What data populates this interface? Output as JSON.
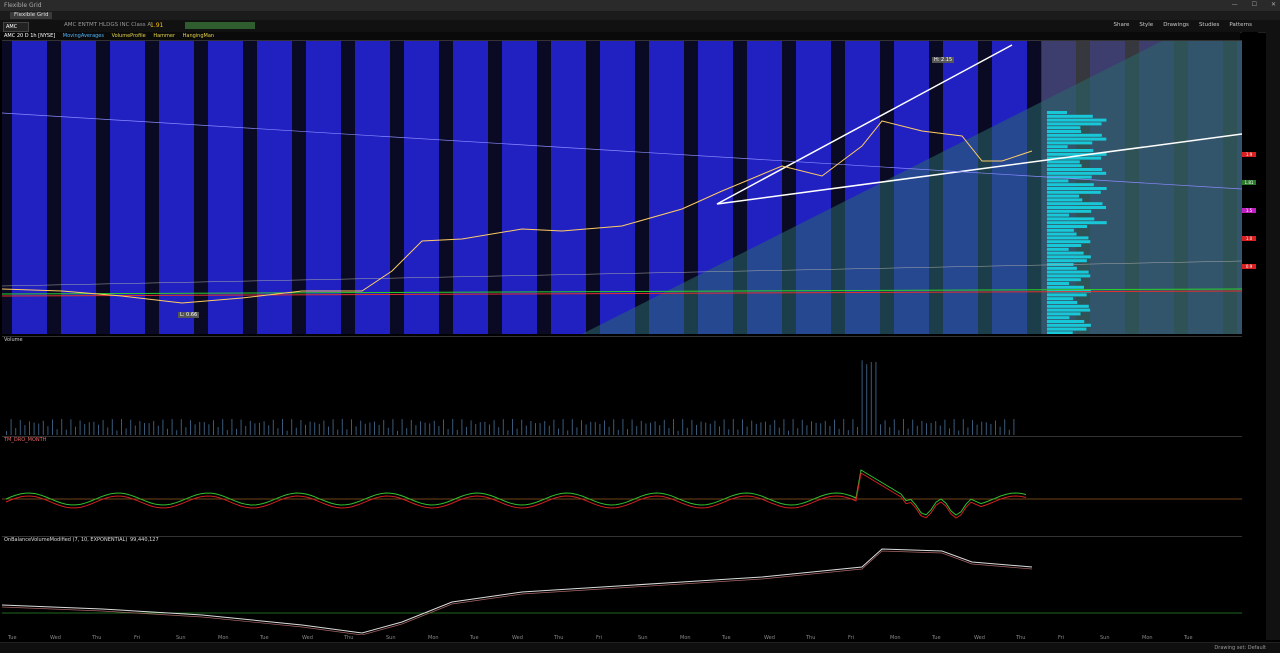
{
  "window": {
    "title": "Flexible Grid",
    "tab": "Flexible Grid"
  },
  "toolbar": {
    "symbol": "AMC",
    "quote_text": "AMC ENTMT HLDGS INC Class A",
    "last_price": "1.91",
    "right_items": [
      "Share",
      "Style",
      "Drawings",
      "Studies",
      "Patterns"
    ]
  },
  "infobar": {
    "symbol_label": "AMC 20 D 1h [NYSE]",
    "study_1": "MovingAverages",
    "study_2": "VolumeProfile",
    "study_3": "Hammer",
    "study_4": "HangingMan"
  },
  "price_callouts": {
    "high": "H: 2.15",
    "low": "L: 0.66"
  },
  "panels": {
    "volume_label": "Volume",
    "oscillator_label": "TM_DRO_MONTH",
    "obv_label": "OnBalanceVolumeModified (7, 10, EXPONENTIAL)",
    "obv_value": "99,440,127"
  },
  "x_axis": [
    "Tue",
    "Wed",
    "Thu",
    "Fri",
    "Sun",
    "Mon",
    "Tue",
    "Wed",
    "Thu",
    "Sun",
    "Mon",
    "Tue",
    "Wed",
    "Thu",
    "Fri",
    "Sun",
    "Mon",
    "Tue",
    "Wed",
    "Thu",
    "Fri",
    "Mon",
    "Tue",
    "Wed",
    "Thu",
    "Fri",
    "Sun",
    "Mon",
    "Tue"
  ],
  "price_badges": [
    {
      "label": "1.9",
      "color": "#d82020"
    },
    {
      "label": "1.81",
      "color": "#2a7a2a"
    },
    {
      "label": "1.5",
      "color": "#c020c0"
    },
    {
      "label": "1.0",
      "color": "#d82020"
    },
    {
      "label": "0.9",
      "color": "#d82020"
    }
  ],
  "status": {
    "drawing_set": "Drawing set: Default"
  },
  "colors": {
    "blue_band": "#2020c0",
    "dark_band": "#0a0a2a",
    "accent": "#f3c000"
  }
}
